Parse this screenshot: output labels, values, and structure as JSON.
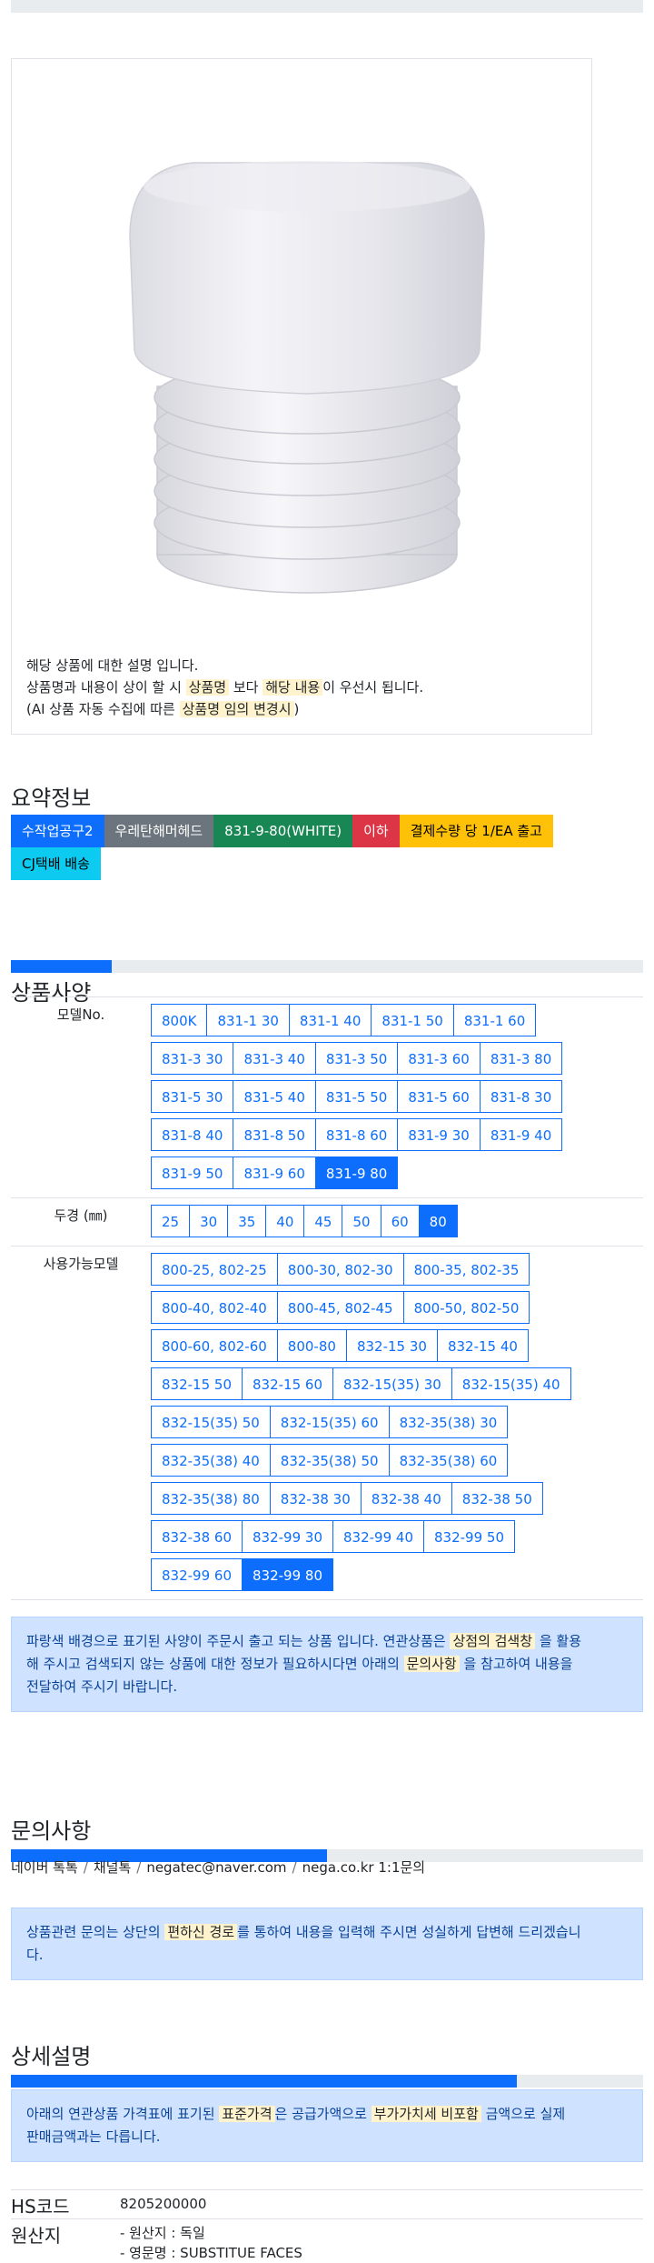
{
  "product": {
    "image_icon": "hammer-face-cap-image",
    "desc_line1": "해당 상품에 대한 설명 입니다.",
    "desc_line2_a": "상품명과 내용이 상이 할 시",
    "desc_line2_hl1": "상품명",
    "desc_line2_b": "보다",
    "desc_line2_hl2": "해당 내용",
    "desc_line2_c": "이 우선시 됩니다.",
    "desc_line3_a": "(AI 상품 자동 수집에 따른",
    "desc_line3_hl": "상품명 임의 변경시",
    "desc_line3_b": ")"
  },
  "summary": {
    "title": "요약정보",
    "badges": [
      {
        "label": "수작업공구2",
        "color": "#0d6efd",
        "text_color": "#ffffff"
      },
      {
        "label": "우레탄해머헤드",
        "color": "#6c757d",
        "text_color": "#ffffff"
      },
      {
        "label": "831-9-80(WHITE)",
        "color": "#198754",
        "text_color": "#ffffff"
      },
      {
        "label": "이하",
        "color": "#dc3545",
        "text_color": "#ffffff"
      },
      {
        "label": "결제수량 당 1/EA 출고",
        "color": "#ffc107",
        "text_color": "#000000"
      },
      {
        "label": "CJ택배 배송",
        "color": "#0dcaf0",
        "text_color": "#000000"
      }
    ]
  },
  "spec": {
    "progress_percent": 16,
    "title": "상품사양",
    "rows": [
      {
        "label": "모델No.",
        "lines": [
          [
            "800K",
            "831-1 30",
            "831-1 40",
            "831-1 50",
            "831-1 60"
          ],
          [
            "831-3 30",
            "831-3 40",
            "831-3 50",
            "831-3 60",
            "831-3 80"
          ],
          [
            "831-5 30",
            "831-5 40",
            "831-5 50",
            "831-5 60",
            "831-8 30"
          ],
          [
            "831-8 40",
            "831-8 50",
            "831-8 60",
            "831-9 30",
            "831-9 40"
          ],
          [
            "831-9 50",
            "831-9 60",
            "831-9 80"
          ]
        ],
        "selected": "831-9 80"
      },
      {
        "label": "두경 (㎜)",
        "lines": [
          [
            "25",
            "30",
            "35",
            "40",
            "45",
            "50",
            "60",
            "80"
          ]
        ],
        "selected": "80"
      },
      {
        "label": "사용가능모델",
        "lines": [
          [
            "800-25, 802-25",
            "800-30, 802-30",
            "800-35, 802-35"
          ],
          [
            "800-40, 802-40",
            "800-45, 802-45",
            "800-50, 802-50"
          ],
          [
            "800-60, 802-60",
            "800-80",
            "832-15 30",
            "832-15 40"
          ],
          [
            "832-15 50",
            "832-15 60",
            "832-15(35) 30",
            "832-15(35) 40"
          ],
          [
            "832-15(35) 50",
            "832-15(35) 60",
            "832-35(38) 30"
          ],
          [
            "832-35(38) 40",
            "832-35(38) 50",
            "832-35(38) 60"
          ],
          [
            "832-35(38) 80",
            "832-38 30",
            "832-38 40",
            "832-38 50"
          ],
          [
            "832-38 60",
            "832-99 30",
            "832-99 40",
            "832-99 50"
          ],
          [
            "832-99 60",
            "832-99 80"
          ]
        ],
        "selected": "832-99 80"
      }
    ],
    "note_a": "파랑색 배경으로 표기된 사양이 주문시 출고 되는 상품 입니다. 연관상품은",
    "note_hl1": "상점의 검색창",
    "note_b": "을 활용",
    "note_c": "해 주시고 검색되지 않는 상품에 대한 정보가 필요하시다면 아래의",
    "note_hl2": "문의사항",
    "note_d": "을 참고하여 내용을",
    "note_e": "전달하여 주시기 바랍니다."
  },
  "inquiry": {
    "title": "문의사항",
    "progress_percent": 50,
    "links": [
      "네이버 톡톡",
      "채널톡",
      "negatec@naver.com",
      "nega.co.kr 1:1문의"
    ],
    "separator": "/",
    "note_a": "상품관련 문의는 상단의",
    "note_hl": "편하신 경로",
    "note_b": "를 통하여 내용을 입력해 주시면 성실하게 답변해 드리겠습니",
    "note_c": "다."
  },
  "detail": {
    "title": "상세설명",
    "progress_percent": 80,
    "note_a": "아래의 연관상품 가격표에 표기된",
    "note_hl1": "표준가격",
    "note_b": "은 공급가액으로",
    "note_hl2": "부가가치세 비포함",
    "note_c": "금액으로 실제",
    "note_d": "판매금액과는 다릅니다."
  },
  "info": {
    "hs_label": "HS코드",
    "hs_value": "8205200000",
    "origin_label": "원산지",
    "origin_line1": "- 원산지 : 독일",
    "origin_line2": "- 영문명 : SUBSTITUE FACES"
  }
}
